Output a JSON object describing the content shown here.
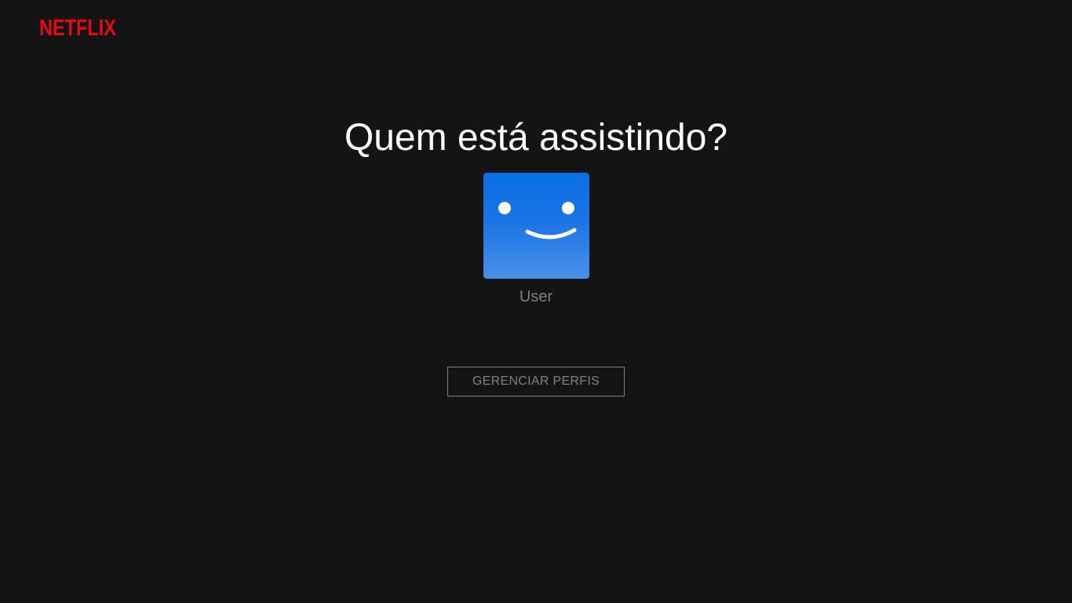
{
  "header": {
    "logo_text": "NETFLIX",
    "logo_color": "#e50914"
  },
  "main": {
    "title": "Quem está assistindo?",
    "profiles": [
      {
        "name": "User",
        "avatar_icon": "smiley-face-icon",
        "avatar_color_top": "#0a6fe6",
        "avatar_color_bottom": "#4a90e8"
      }
    ],
    "manage_button_label": "GERENCIAR PERFIS"
  },
  "colors": {
    "background": "#141414",
    "title": "#ffffff",
    "muted": "#808080"
  }
}
